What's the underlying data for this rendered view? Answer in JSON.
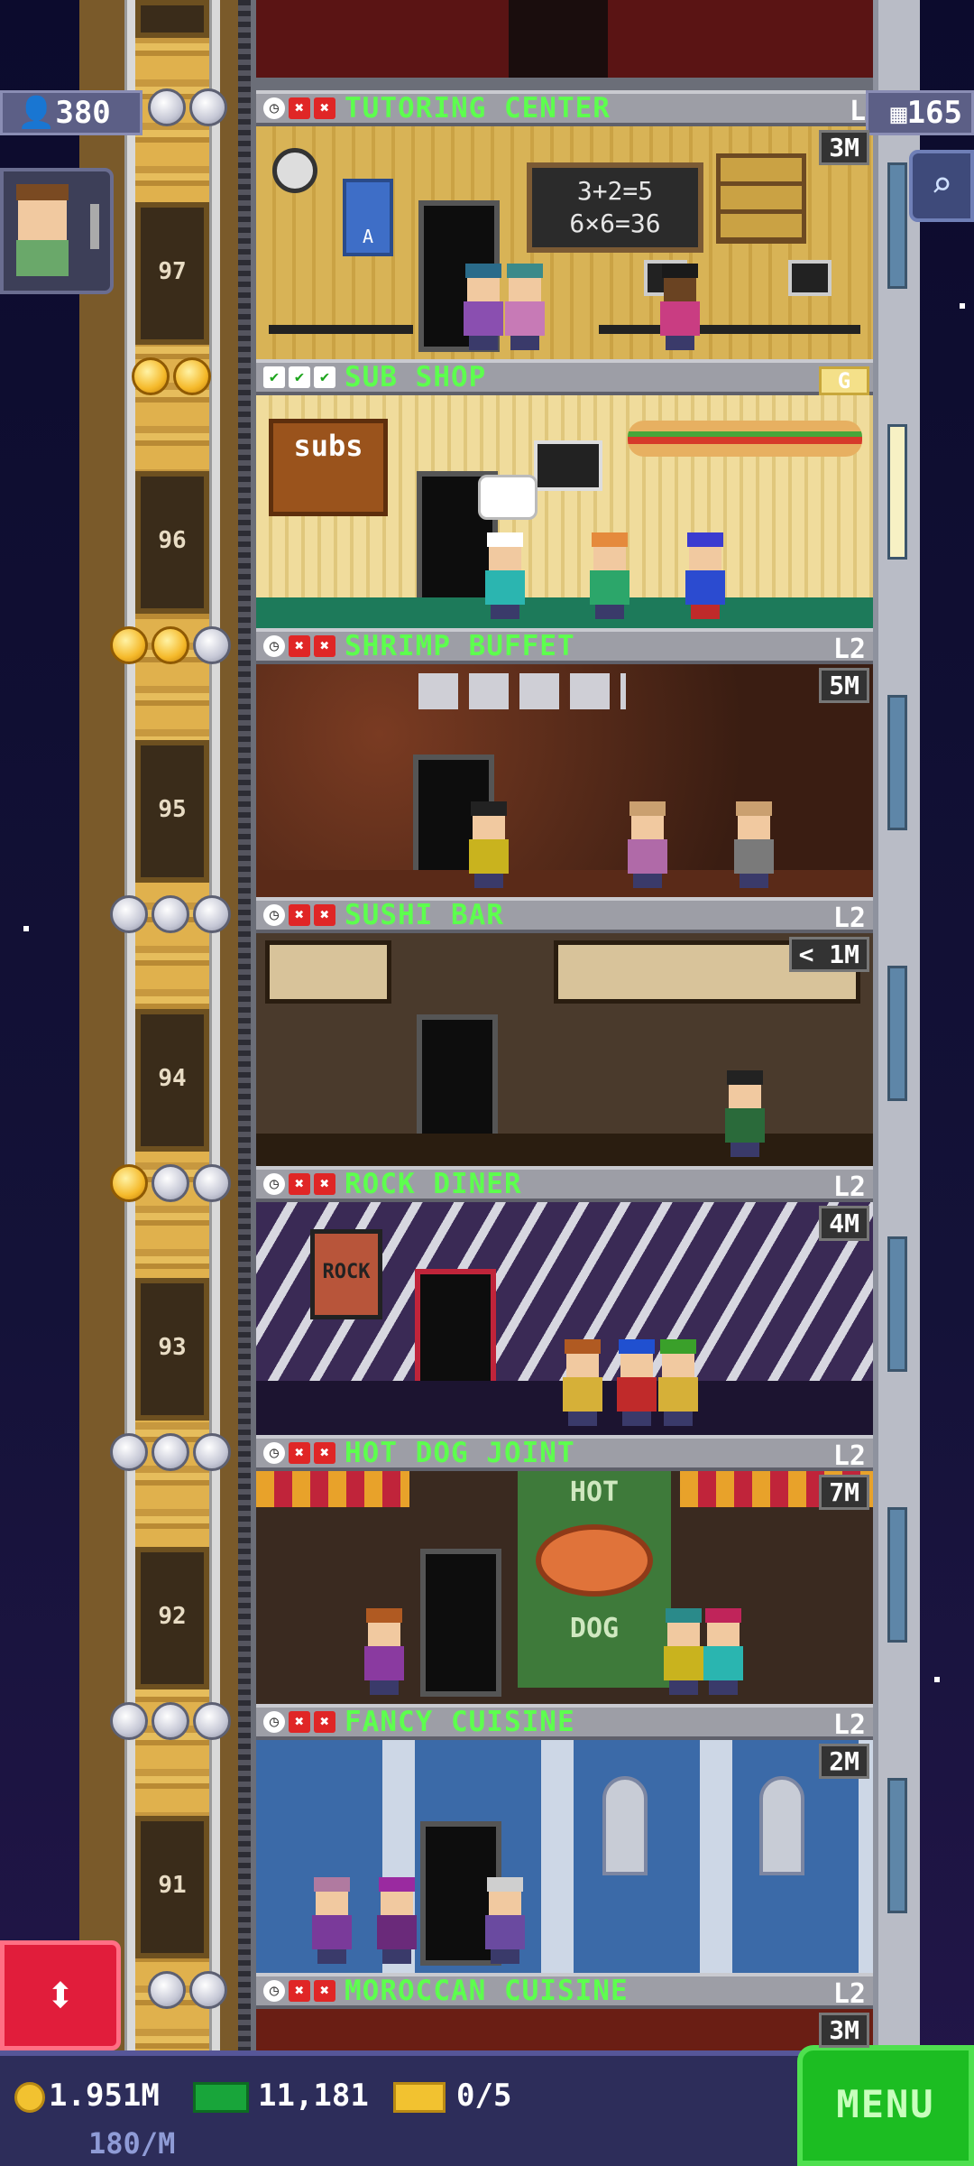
{
  "hud": {
    "population": "380",
    "floor_count": "165"
  },
  "floors": [
    {
      "elevator_no": "97",
      "name": "TUTORING CENTER",
      "level": "L",
      "timer": "3M",
      "status": [
        "clock",
        "x",
        "x"
      ],
      "stars": [
        "silver",
        "silver"
      ]
    },
    {
      "elevator_no": "96",
      "name": "SUB SHOP",
      "level": "",
      "gold_label": "G",
      "timer": "",
      "status": [
        "check",
        "check",
        "check"
      ],
      "stars": [
        "gold",
        "gold"
      ]
    },
    {
      "elevator_no": "95",
      "name": "SHRIMP BUFFET",
      "level": "L2",
      "timer": "5M",
      "status": [
        "clock",
        "x",
        "x"
      ],
      "stars": [
        "gold",
        "gold",
        "silver"
      ]
    },
    {
      "elevator_no": "94",
      "name": "SUSHI BAR",
      "level": "L2",
      "timer": "< 1M",
      "status": [
        "clock",
        "x",
        "x"
      ],
      "stars": [
        "silver",
        "silver",
        "silver"
      ]
    },
    {
      "elevator_no": "93",
      "name": "ROCK DINER",
      "level": "L2",
      "timer": "4M",
      "status": [
        "clock",
        "x",
        "x"
      ],
      "stars": [
        "gold",
        "silver",
        "silver"
      ]
    },
    {
      "elevator_no": "92",
      "name": "HOT DOG JOINT",
      "level": "L2",
      "timer": "7M",
      "status": [
        "clock",
        "x",
        "x"
      ],
      "stars": [
        "silver",
        "silver",
        "silver"
      ]
    },
    {
      "elevator_no": "91",
      "name": "FANCY CUISINE",
      "level": "L2",
      "timer": "2M",
      "status": [
        "clock",
        "x",
        "x"
      ],
      "stars": [
        "silver",
        "silver",
        "silver"
      ]
    },
    {
      "elevator_no": "",
      "name": "MOROCCAN CUISINE",
      "level": "L2",
      "timer": "3M",
      "status": [
        "clock",
        "x",
        "x"
      ],
      "stars": [
        "silver",
        "silver"
      ]
    }
  ],
  "signs": {
    "tutoring_board": "3+2=5 6×6=36",
    "tutoring_poster": "A",
    "sub_menu": "subs",
    "hotdog_top": "HOT",
    "hotdog_bottom": "DOG",
    "rock_poster": "ROCK"
  },
  "bottom": {
    "coins": "1.951M",
    "coin_rate": "180/M",
    "bux": "11,181",
    "tickets": "0/5",
    "menu_label": "MENU"
  },
  "colors": {
    "floor_name": "#5dff4e",
    "menu_green": "#1cbd22",
    "elevator_button": "#e11d3b"
  }
}
